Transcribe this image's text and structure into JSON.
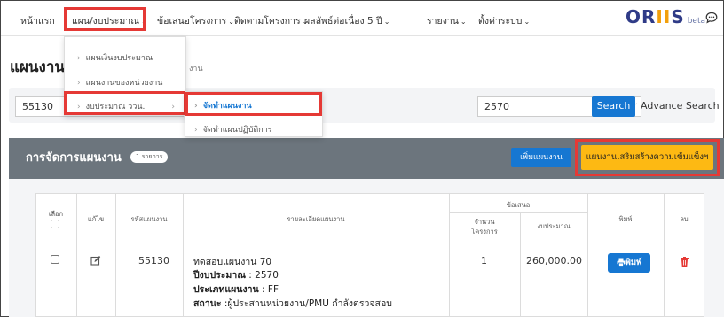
{
  "nav": {
    "items": [
      {
        "label": "หน้าแรก",
        "chevron": false
      },
      {
        "label": "แผน/งบประมาณ",
        "chevron": true
      },
      {
        "label": "ข้อเสนอโครงการ",
        "chevron": true
      },
      {
        "label": "ติดตามโครงการ",
        "chevron": true
      },
      {
        "label": "ผลลัพธ์ต่อเนื่อง 5 ปี",
        "chevron": true
      },
      {
        "label": "รายงาน",
        "chevron": true
      },
      {
        "label": "ตั้งค่าระบบ",
        "chevron": true
      }
    ],
    "logo_parts": {
      "o": "O",
      "r": "R",
      "ii": "II",
      "s": "S",
      "beta": "beta"
    },
    "chevron_glyph": "⌄"
  },
  "page": {
    "title": "แผนงาน",
    "breadcrumb": "งาน"
  },
  "dropdown": {
    "items": [
      "แผนเงินงบประมาณ",
      "แผนงานของหน่วยงาน",
      "งบประมาณ ววน."
    ],
    "submenu": [
      "จัดทำแผนงาน",
      "จัดทำแผนปฏิบัติการ"
    ]
  },
  "search": {
    "code_value": "55130",
    "year_value": "2570",
    "search_label": "Search",
    "advance_label": "Advance Search"
  },
  "card": {
    "title": "การจัดการแผนงาน",
    "badge": "1 รายการ",
    "add_label": "เพิ่มแผนงาน",
    "extra_label": "แผนงานเสริมสร้างความเข้มแข็งฯ"
  },
  "table": {
    "headers": {
      "select": "เลือก",
      "edit": "แก้ไข",
      "code": "รหัสแผนงาน",
      "detail": "รายละเอียดแผนงาน",
      "proposal": "ข้อเสนอ",
      "count": "จำนวน\nโครงการ",
      "budget": "งบประมาณ",
      "print": "พิมพ์",
      "delete": "ลบ"
    },
    "row": {
      "code": "55130",
      "name": "ทดสอบแผนงาน 70",
      "year_label": "ปีงบประมาณ",
      "year": " : 2570",
      "type_label": "ประเภทแผนงาน",
      "type": " : FF",
      "status_label": "สถานะ",
      "status": " :ผู้ประสานหน่วยงาน/PMU กำลังตรวจสอบ",
      "count": "1",
      "budget": "260,000.00",
      "print_label": "พิมพ์"
    }
  },
  "colors": {
    "primary": "#1677d2",
    "warning": "#fdb913",
    "highlight": "#e53935",
    "card_header": "#6c757d",
    "danger": "#e53935"
  }
}
